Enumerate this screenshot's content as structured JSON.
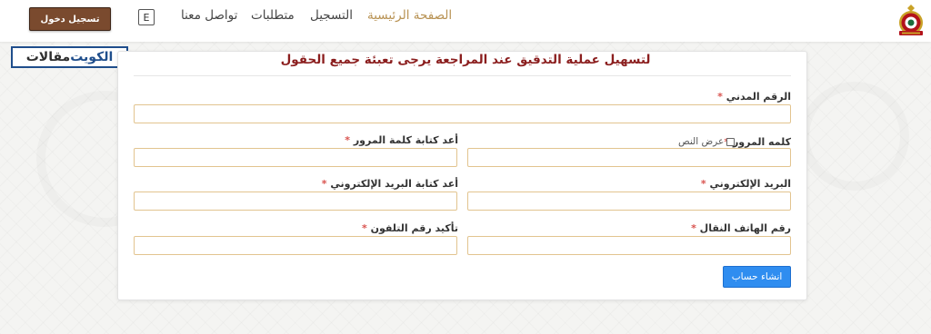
{
  "header": {
    "login_button": "تسجيل دخول",
    "language_button": "E",
    "nav": [
      {
        "label": "الصفحة الرئيسية",
        "active": true
      },
      {
        "label": "التسجيل",
        "active": false
      },
      {
        "label": "متطلبات",
        "active": false
      },
      {
        "label": "تواصل معنا",
        "active": false
      }
    ],
    "logo_icon": "police-emblem-icon"
  },
  "watermark": {
    "part_a": "الكويت",
    "part_b": "مقالات"
  },
  "form": {
    "title": "لتسهيل عملية التدقيق عند المراجعة يرجى تعبئة جميع الحقول",
    "required_mark": "*",
    "civil_id_label": "الرقم المدني",
    "password_label": "كلمه المرور",
    "show_text_label": "عرض النص",
    "confirm_password_label": "أعد كتابة كلمة المرور",
    "email_label": "البريد الإلكتروني",
    "confirm_email_label": "أعد كتابة البريد الإلكتروني",
    "mobile_label": "رقم الهاتف النقال",
    "confirm_phone_label": "تأكيد رقم التلفون",
    "submit_button": "انشاء حساب"
  },
  "colors": {
    "accent_gold": "#b89253",
    "title_red": "#8b1e1e",
    "login_brown": "#7a4a2e",
    "submit_blue": "#2f8df0",
    "required_red": "#d9534f"
  }
}
